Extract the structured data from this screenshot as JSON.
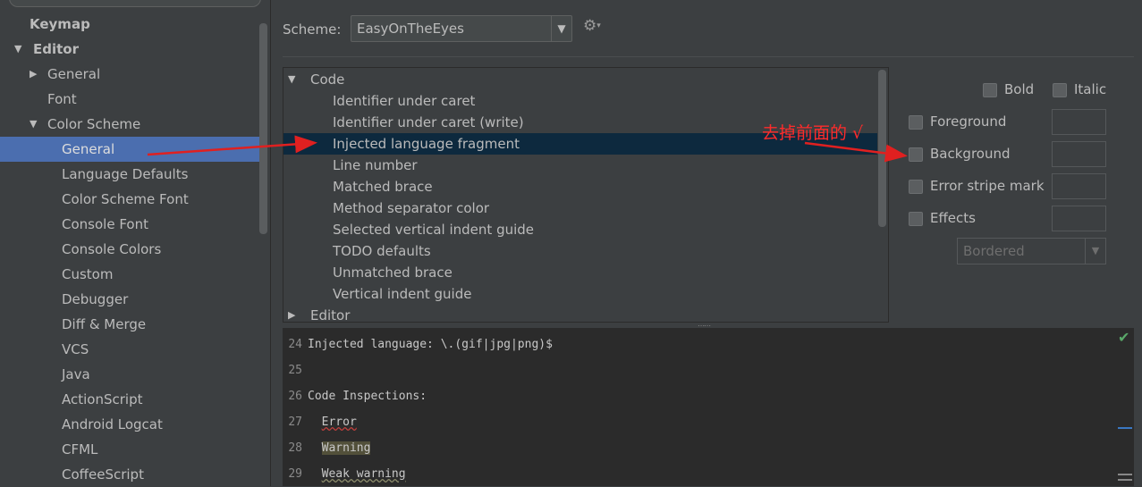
{
  "sidebar": {
    "items": [
      {
        "label": "Keymap",
        "indent": 0,
        "expand": "none",
        "bold": true,
        "selected": false
      },
      {
        "label": "Editor",
        "indent": 0,
        "expand": "open",
        "bold": true,
        "selected": false
      },
      {
        "label": "General",
        "indent": 1,
        "expand": "closed",
        "bold": false,
        "selected": false
      },
      {
        "label": "Font",
        "indent": 1,
        "expand": "none",
        "bold": false,
        "selected": false
      },
      {
        "label": "Color Scheme",
        "indent": 1,
        "expand": "open",
        "bold": false,
        "selected": false
      },
      {
        "label": "General",
        "indent": 2,
        "expand": "none",
        "bold": false,
        "selected": true
      },
      {
        "label": "Language Defaults",
        "indent": 2,
        "expand": "none",
        "bold": false,
        "selected": false
      },
      {
        "label": "Color Scheme Font",
        "indent": 2,
        "expand": "none",
        "bold": false,
        "selected": false
      },
      {
        "label": "Console Font",
        "indent": 2,
        "expand": "none",
        "bold": false,
        "selected": false
      },
      {
        "label": "Console Colors",
        "indent": 2,
        "expand": "none",
        "bold": false,
        "selected": false
      },
      {
        "label": "Custom",
        "indent": 2,
        "expand": "none",
        "bold": false,
        "selected": false
      },
      {
        "label": "Debugger",
        "indent": 2,
        "expand": "none",
        "bold": false,
        "selected": false
      },
      {
        "label": "Diff & Merge",
        "indent": 2,
        "expand": "none",
        "bold": false,
        "selected": false
      },
      {
        "label": "VCS",
        "indent": 2,
        "expand": "none",
        "bold": false,
        "selected": false
      },
      {
        "label": "Java",
        "indent": 2,
        "expand": "none",
        "bold": false,
        "selected": false
      },
      {
        "label": "ActionScript",
        "indent": 2,
        "expand": "none",
        "bold": false,
        "selected": false
      },
      {
        "label": "Android Logcat",
        "indent": 2,
        "expand": "none",
        "bold": false,
        "selected": false
      },
      {
        "label": "CFML",
        "indent": 2,
        "expand": "none",
        "bold": false,
        "selected": false
      },
      {
        "label": "CoffeeScript",
        "indent": 2,
        "expand": "none",
        "bold": false,
        "selected": false
      }
    ]
  },
  "scheme": {
    "label": "Scheme:",
    "value": "EasyOnTheEyes"
  },
  "attributes": {
    "items": [
      {
        "label": "Code",
        "level": 0,
        "expand": "open",
        "selected": false
      },
      {
        "label": "Identifier under caret",
        "level": 1,
        "expand": "none",
        "selected": false
      },
      {
        "label": "Identifier under caret (write)",
        "level": 1,
        "expand": "none",
        "selected": false
      },
      {
        "label": "Injected language fragment",
        "level": 1,
        "expand": "none",
        "selected": true
      },
      {
        "label": "Line number",
        "level": 1,
        "expand": "none",
        "selected": false
      },
      {
        "label": "Matched brace",
        "level": 1,
        "expand": "none",
        "selected": false
      },
      {
        "label": "Method separator color",
        "level": 1,
        "expand": "none",
        "selected": false
      },
      {
        "label": "Selected vertical indent guide",
        "level": 1,
        "expand": "none",
        "selected": false
      },
      {
        "label": "TODO defaults",
        "level": 1,
        "expand": "none",
        "selected": false
      },
      {
        "label": "Unmatched brace",
        "level": 1,
        "expand": "none",
        "selected": false
      },
      {
        "label": "Vertical indent guide",
        "level": 1,
        "expand": "none",
        "selected": false
      },
      {
        "label": "Editor",
        "level": 0,
        "expand": "closed",
        "selected": false
      }
    ]
  },
  "options": {
    "bold": "Bold",
    "italic": "Italic",
    "foreground": "Foreground",
    "background": "Background",
    "error_stripe": "Error stripe mark",
    "effects": "Effects",
    "effect_type": "Bordered"
  },
  "annotation": "去掉前面的 √",
  "preview": {
    "lines": [
      {
        "num": "24",
        "segments": [
          {
            "text": "Injected language: \\.(gif|jpg|png)$",
            "style": ""
          }
        ]
      },
      {
        "num": "25",
        "segments": []
      },
      {
        "num": "26",
        "segments": [
          {
            "text": "Code Inspections:",
            "style": ""
          }
        ]
      },
      {
        "num": "27",
        "segments": [
          {
            "text": "  ",
            "style": ""
          },
          {
            "text": "Error",
            "style": "err"
          }
        ]
      },
      {
        "num": "28",
        "segments": [
          {
            "text": "  ",
            "style": ""
          },
          {
            "text": "Warning",
            "style": "warn"
          }
        ]
      },
      {
        "num": "29",
        "segments": [
          {
            "text": "  ",
            "style": ""
          },
          {
            "text": "Weak warning",
            "style": "weak"
          }
        ]
      }
    ]
  },
  "colors": {
    "background": "#3c3f41",
    "selection_sidebar": "#4b6eaf",
    "selection_tree": "#0d293e",
    "editor_bg": "#2b2b2b",
    "annotation": "#ff2b2b",
    "check": "#59a869"
  }
}
